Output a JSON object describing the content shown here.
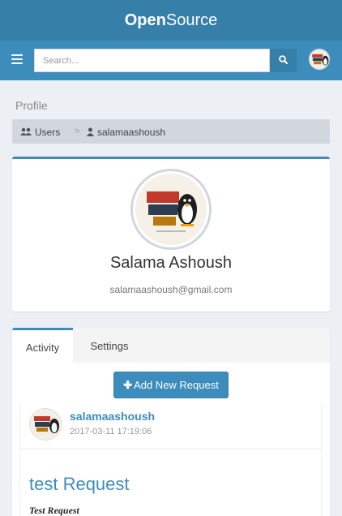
{
  "app": {
    "brand_bold": "Open",
    "brand_light": "Source"
  },
  "navbar": {
    "menu_icon": "bars-icon",
    "search": {
      "placeholder": "Search...",
      "value": "",
      "button_icon": "search-icon"
    }
  },
  "page": {
    "title": "Profile",
    "breadcrumb": [
      {
        "label": "Users",
        "icon": "users-icon"
      },
      {
        "label": "salamaashoush",
        "icon": "user-icon"
      }
    ],
    "breadcrumb_separator": ">"
  },
  "profile": {
    "name": "Salama Ashoush",
    "email": "salamaashoush@gmail.com"
  },
  "tabs": [
    {
      "label": "Activity",
      "active": true
    },
    {
      "label": "Settings",
      "active": false
    }
  ],
  "activity": {
    "add_button_label": "Add New Request",
    "posts": [
      {
        "username": "salamaashoush",
        "timestamp": "2017-03-11 17:19:06",
        "title": "test Request",
        "body": "Test Request"
      }
    ]
  },
  "colors": {
    "primary": "#3c8dbc",
    "primary_dark": "#367fa9",
    "background": "#ecf0f5"
  }
}
